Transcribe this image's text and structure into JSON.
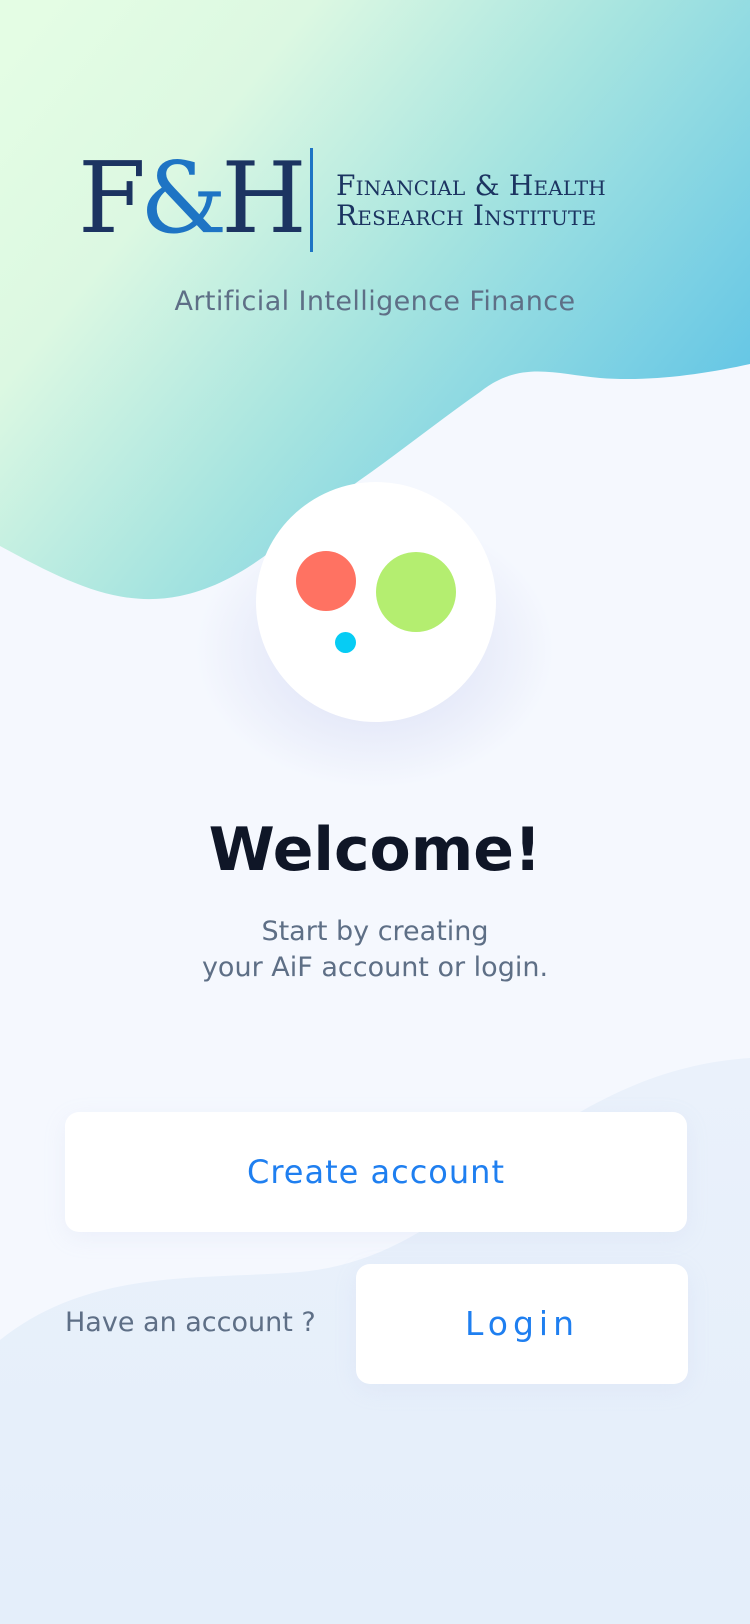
{
  "logo": {
    "monogram_left": "F",
    "monogram_amp": "&",
    "monogram_right": "H",
    "line1": "Financial & Health",
    "line2": "Research Institute"
  },
  "tagline": "Artificial Intelligence Finance",
  "emblem": {
    "icon": "app-logo-dots-icon",
    "colors": [
      "#ff7262",
      "#b4ee70",
      "#06ccf4"
    ]
  },
  "welcome": {
    "title": "Welcome!",
    "subtitle_line1": "Start by creating",
    "subtitle_line2": "your AiF account or login."
  },
  "actions": {
    "create_account": "Create account",
    "have_account": "Have an account ?",
    "login": "Login"
  },
  "colors": {
    "accent": "#1f7ff0",
    "brand_navy": "#1c3461",
    "brand_blue": "#1e74c4",
    "title_text": "#0f1627",
    "body_text": "#5e6f86",
    "background": "#f5f8fe"
  }
}
